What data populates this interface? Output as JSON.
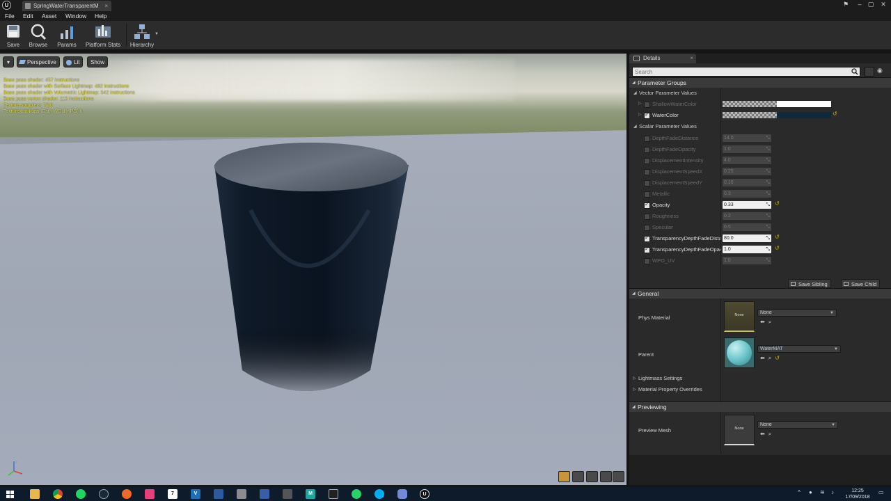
{
  "window": {
    "document_tab_title": "SpringWaterTransparentM",
    "close_glyph": "×"
  },
  "menu": [
    "File",
    "Edit",
    "Asset",
    "Window",
    "Help"
  ],
  "toolbar": {
    "buttons": [
      {
        "label": "Save",
        "icon": "save-icon"
      },
      {
        "label": "Browse",
        "icon": "browse-icon"
      },
      {
        "label": "Params",
        "icon": "params-icon"
      },
      {
        "label": "Platform Stats",
        "icon": "platform-stats-icon"
      },
      {
        "label": "Hierarchy",
        "icon": "hierarchy-icon"
      }
    ]
  },
  "viewport": {
    "perspective_label": "Perspective",
    "lit_label": "Lit",
    "show_label": "Show",
    "stats": [
      "Base pass shader: 457 instructions",
      "Base pass shader with Surface Lightmap: 492 instructions",
      "Base pass shader with Volumetric Lightmap: 542 instructions",
      "Base pass vertex shader: 113 instructions",
      "Texture samplers: 7/16",
      "Texture Lookups (Est.): VS(1), PS(0)"
    ]
  },
  "details": {
    "tab_title": "Details",
    "search_placeholder": "Search",
    "parameter_groups_title": "Parameter Groups",
    "vector_title": "Vector Parameter Values",
    "scalar_title": "Scalar Parameter Values",
    "vector_params": [
      {
        "name": "ShallowWaterColor",
        "enabled": false,
        "color": "#ffffff"
      },
      {
        "name": "WaterColor",
        "enabled": true,
        "color": "#0c2a3c"
      }
    ],
    "scalar_params": [
      {
        "name": "DepthFadeDistance",
        "value": "14.0",
        "enabled": false
      },
      {
        "name": "DepthFadeOpacity",
        "value": "1.0",
        "enabled": false
      },
      {
        "name": "DisplacementIntensity",
        "value": "4.0",
        "enabled": false
      },
      {
        "name": "DisplacementSpeedX",
        "value": "0.25",
        "enabled": false
      },
      {
        "name": "DisplacementSpeedY",
        "value": "0.16",
        "enabled": false
      },
      {
        "name": "Metallic",
        "value": "0.3",
        "enabled": false
      },
      {
        "name": "Opacity",
        "value": "0.33",
        "enabled": true
      },
      {
        "name": "Roughness",
        "value": "0.2",
        "enabled": false
      },
      {
        "name": "Specular",
        "value": "0.5",
        "enabled": false
      },
      {
        "name": "TransparencyDepthFadeDista",
        "value": "80.0",
        "enabled": true
      },
      {
        "name": "TransparencyDepthFadeOpac",
        "value": "1.0",
        "enabled": true
      },
      {
        "name": "WPO_UV",
        "value": "1.0",
        "enabled": false
      }
    ],
    "save_sibling_label": "Save Sibling",
    "save_child_label": "Save Child",
    "general_title": "General",
    "phys_material_label": "Phys Material",
    "phys_material_value": "None",
    "phys_material_thumb": "None",
    "parent_label": "Parent",
    "parent_value": "WaterMAT",
    "lightmass_label": "Lightmass Settings",
    "overrides_label": "Material Property Overrides",
    "previewing_title": "Previewing",
    "preview_mesh_label": "Preview Mesh",
    "preview_mesh_value": "None",
    "preview_mesh_thumb": "None"
  },
  "taskbar": {
    "time": "12:25",
    "date": "17/09/2018"
  }
}
